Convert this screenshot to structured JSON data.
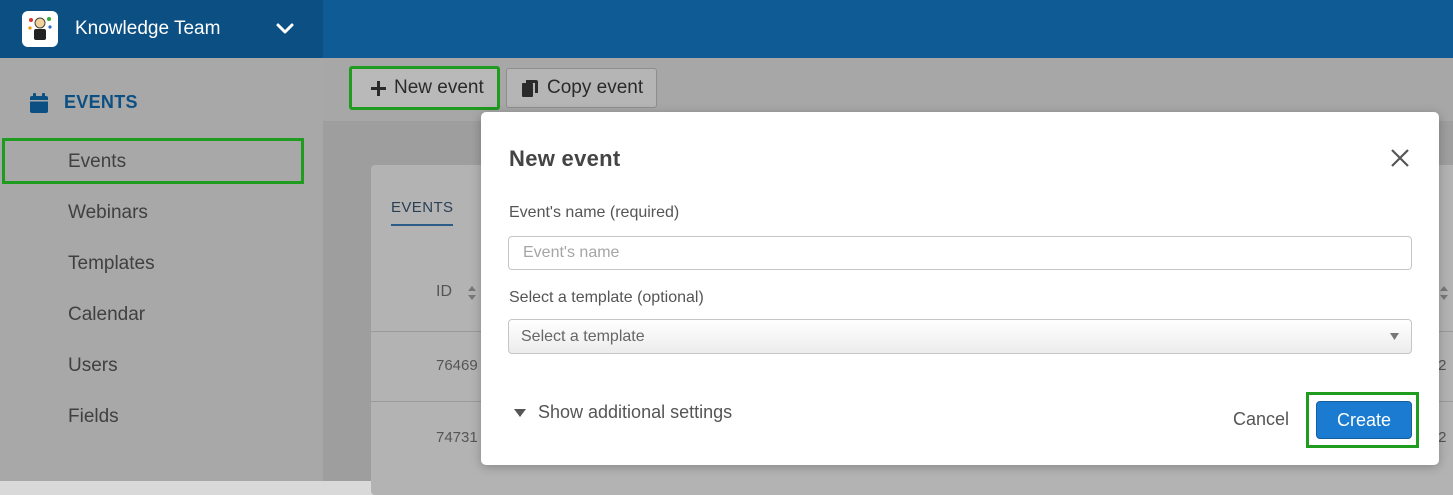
{
  "header": {
    "org_name": "Knowledge Team"
  },
  "sidebar": {
    "section_title": "EVENTS",
    "items": [
      {
        "label": "Events",
        "selected": true
      },
      {
        "label": "Webinars"
      },
      {
        "label": "Templates"
      },
      {
        "label": "Calendar"
      },
      {
        "label": "Users"
      },
      {
        "label": "Fields"
      }
    ]
  },
  "toolbar": {
    "new_event_label": "New event",
    "copy_event_label": "Copy event"
  },
  "card": {
    "tab_label": "EVENTS",
    "id_header": "ID",
    "rows": [
      {
        "id": "76469",
        "right": "/2"
      },
      {
        "id": "74731",
        "right": "/2"
      }
    ]
  },
  "modal": {
    "title": "New event",
    "name_label": "Event's name (required)",
    "name_placeholder": "Event's name",
    "template_label": "Select a template (optional)",
    "template_placeholder": "Select a template",
    "additional_settings": "Show additional settings",
    "cancel_label": "Cancel",
    "create_label": "Create"
  },
  "colors": {
    "brand": "#0e5b96",
    "primary_button": "#1a7bd0",
    "highlight": "#1f9b1f"
  }
}
